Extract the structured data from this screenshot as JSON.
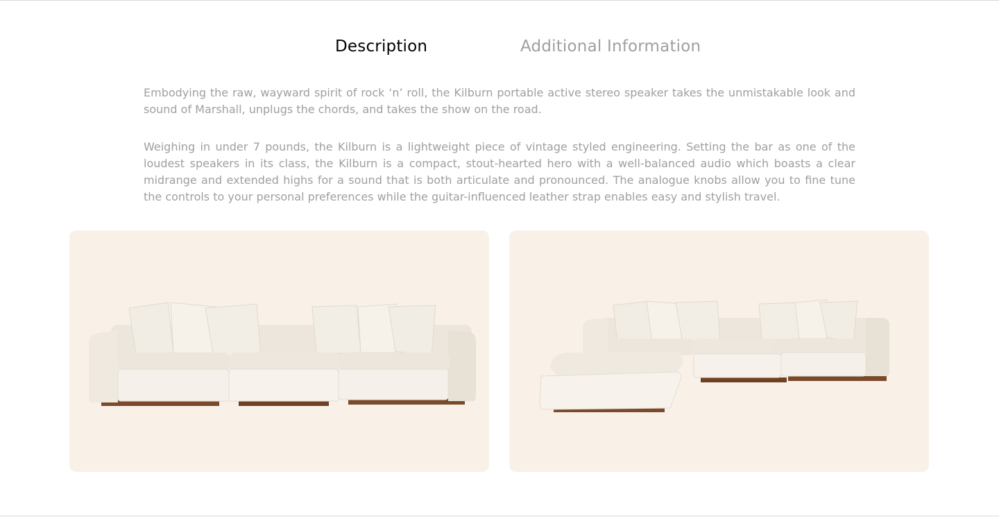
{
  "tabs": [
    {
      "label": "Description",
      "active": true
    },
    {
      "label": "Additional Information",
      "active": false
    }
  ],
  "description": {
    "paragraphs": [
      "Embodying the raw, wayward spirit of rock ‘n’ roll, the Kilburn portable active stereo speaker takes the unmistakable look and sound of Marshall, unplugs the chords, and takes the show on the road.",
      "Weighing in under 7 pounds, the Kilburn is a lightweight piece of vintage styled engineering. Setting the bar as one of the loudest speakers in its class, the Kilburn is a compact, stout-hearted hero with a well-balanced audio which boasts a clear midrange and extended highs for a sound that is both articulate and pronounced. The analogue knobs allow you to fine tune the controls to your personal preferences while the guitar-influenced leather strap enables easy and stylish travel."
    ]
  },
  "gallery": {
    "images": [
      {
        "subject": "three-seat modular sofa"
      },
      {
        "subject": "sectional modular sofa with ottoman"
      }
    ]
  },
  "colors": {
    "active_tab": "#000000",
    "inactive_tab": "#9f9f9f",
    "body_text": "#9f9f9f",
    "card_background": "#f9f1e7",
    "sofa_fabric": "#f4f0e8",
    "sofa_base": "#7a4a2b"
  }
}
